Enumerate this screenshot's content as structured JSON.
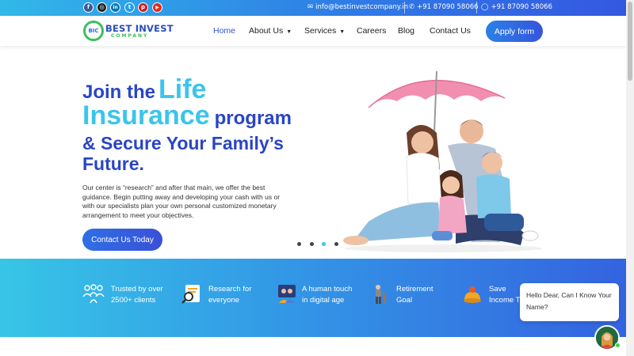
{
  "social": [
    {
      "name": "facebook-icon",
      "glyph": "f",
      "color": "#3b5998"
    },
    {
      "name": "instagram-icon",
      "glyph": "◎",
      "color": "#222222"
    },
    {
      "name": "linkedin-icon",
      "glyph": "in",
      "color": "#0077b5"
    },
    {
      "name": "twitter-icon",
      "glyph": "t",
      "color": "#1da1f2"
    },
    {
      "name": "pinterest-icon",
      "glyph": "p",
      "color": "#cb2027"
    },
    {
      "name": "youtube-icon",
      "glyph": "▶",
      "color": "#e02a20"
    }
  ],
  "contact": {
    "email": "info@bestinvestcompany.in",
    "phone": "+91 87090 58066",
    "whatsapp": "+91 87090 58066"
  },
  "logo": {
    "mark": "BIC",
    "title": "BEST INVEST",
    "subtitle": "COMPANY"
  },
  "nav": {
    "home": "Home",
    "about": "About Us",
    "services": "Services",
    "careers": "Careers",
    "blog": "Blog",
    "contact": "Contact Us",
    "apply": "Apply form"
  },
  "hero": {
    "line1_pre": "Join the",
    "line1_big": "Life",
    "line2_big": "Insurance",
    "line2_post": "program",
    "line3": "& Secure Your Family’s",
    "line4": "Future.",
    "description": "Our center is “research” and after that main, we offer the best guidance. Begin putting away and developing your cash with us or with our specialists plan your own personal customized monetary arrangement to meet your objectives.",
    "cta": "Contact Us Today"
  },
  "slider": {
    "count": 4,
    "active_index": 2
  },
  "features": [
    {
      "line1": "Trusted by over",
      "line2": "2500+ clients",
      "icon": "people-icon"
    },
    {
      "line1": "Research for",
      "line2": "everyone",
      "icon": "research-icon"
    },
    {
      "line1": "A human touch",
      "line2": "in digital age",
      "icon": "handshake-icon"
    },
    {
      "line1": "Retirement",
      "line2": "Goal",
      "icon": "retirement-icon"
    },
    {
      "line1": "Save",
      "line2": "Income T",
      "icon": "savings-icon"
    }
  ],
  "chat": {
    "message": "Hello Dear, Can I Know Your Name?"
  },
  "colors": {
    "brand_blue": "#2a45c4",
    "accent_cyan": "#3cc4ec",
    "brand_green": "#3dbf5a"
  }
}
